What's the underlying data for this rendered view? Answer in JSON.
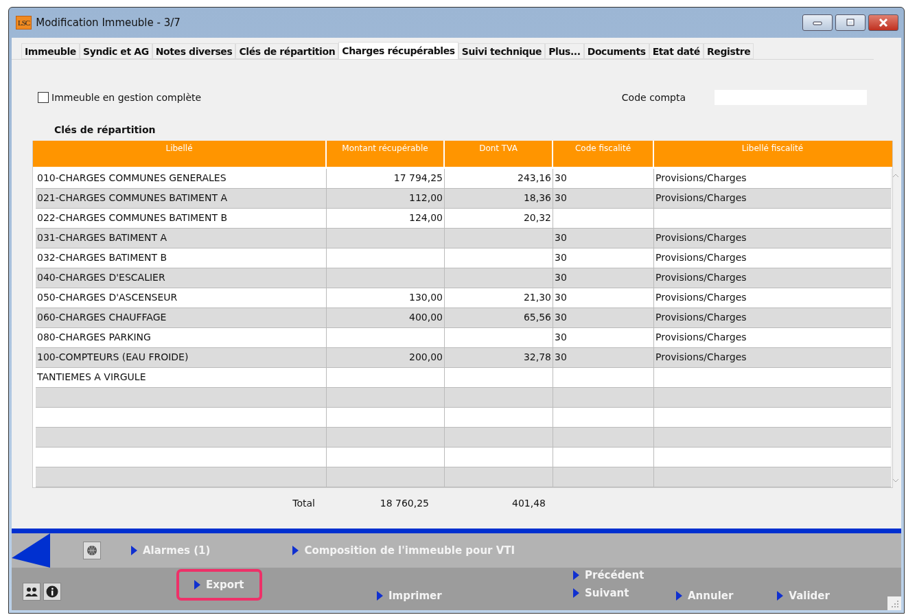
{
  "window": {
    "title": "Modification Immeuble - 3/7",
    "logo": "LSC"
  },
  "tabs": [
    {
      "label": "Immeuble",
      "selected": false
    },
    {
      "label": "Syndic et AG",
      "selected": false
    },
    {
      "label": "Notes diverses",
      "selected": false
    },
    {
      "label": "Clés de répartition",
      "selected": false
    },
    {
      "label": "Charges récupérables",
      "selected": true
    },
    {
      "label": "Suivi technique",
      "selected": false
    },
    {
      "label": "Plus...",
      "selected": false
    },
    {
      "label": "Documents",
      "selected": false
    },
    {
      "label": "Etat daté",
      "selected": false
    },
    {
      "label": "Registre",
      "selected": false
    }
  ],
  "gestion_complete": {
    "label": "Immeuble en gestion complète",
    "checked": false
  },
  "code_compta": {
    "label": "Code compta"
  },
  "section_title": "Clés de répartition",
  "table": {
    "columns": [
      "Libellé",
      "Montant récupérable",
      "Dont TVA",
      "Code fiscalité",
      "Libellé fiscalité"
    ],
    "rows": [
      {
        "libelle": "010-CHARGES COMMUNES GENERALES",
        "montant": "17 794,25",
        "tva": "243,16",
        "code": "30",
        "libelle_fiscalite": "Provisions/Charges"
      },
      {
        "libelle": "021-CHARGES COMMUNES BATIMENT A",
        "montant": "112,00",
        "tva": "18,36",
        "code": "30",
        "libelle_fiscalite": "Provisions/Charges"
      },
      {
        "libelle": "022-CHARGES COMMUNES BATIMENT B",
        "montant": "124,00",
        "tva": "20,32"
      },
      {
        "libelle": "031-CHARGES BATIMENT A",
        "code": "30",
        "libelle_fiscalite": "Provisions/Charges"
      },
      {
        "libelle": "032-CHARGES BATIMENT B",
        "code": "30",
        "libelle_fiscalite": "Provisions/Charges"
      },
      {
        "libelle": "040-CHARGES D'ESCALIER",
        "code": "30",
        "libelle_fiscalite": "Provisions/Charges"
      },
      {
        "libelle": "050-CHARGES D'ASCENSEUR",
        "montant": "130,00",
        "tva": "21,30",
        "code": "30",
        "libelle_fiscalite": "Provisions/Charges"
      },
      {
        "libelle": "060-CHARGES CHAUFFAGE",
        "montant": "400,00",
        "tva": "65,56",
        "code": "30",
        "libelle_fiscalite": "Provisions/Charges"
      },
      {
        "libelle": "080-CHARGES PARKING",
        "code": "30",
        "libelle_fiscalite": "Provisions/Charges"
      },
      {
        "libelle": "100-COMPTEURS (EAU FROIDE)",
        "montant": "200,00",
        "tva": "32,78",
        "code": "30",
        "libelle_fiscalite": "Provisions/Charges"
      },
      {
        "libelle": "TANTIEMES A VIRGULE"
      }
    ]
  },
  "total": {
    "label": "Total",
    "montant": "18 760,25",
    "tva": "401,48"
  },
  "footer": {
    "alarmes": "Alarmes (1)",
    "composition": "Composition de l'immeuble pour VTI",
    "actions": [
      {
        "label": "Export",
        "highlighted": true
      },
      {
        "label": "Imprimer",
        "highlighted": false
      }
    ],
    "navigation": [
      "Précédent",
      "Suivant"
    ],
    "buttons": [
      "Annuler",
      "Valider"
    ]
  }
}
